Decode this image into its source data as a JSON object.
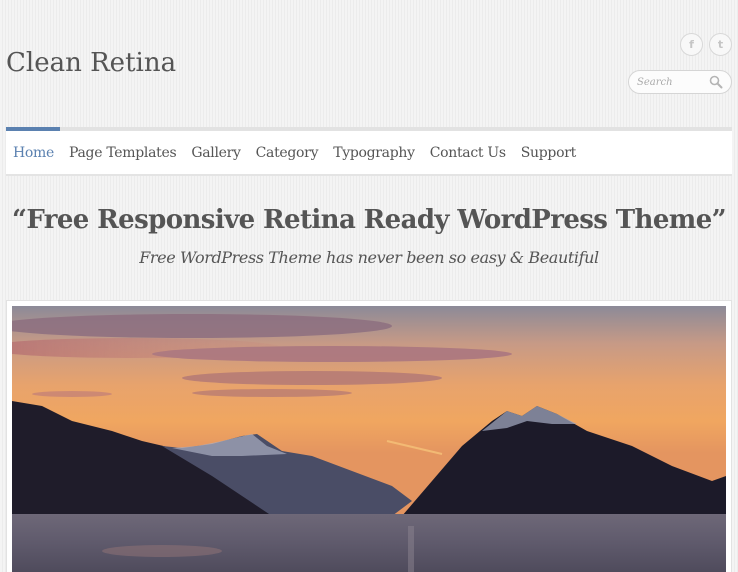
{
  "site": {
    "title": "Clean Retina"
  },
  "social": {
    "facebook": {
      "icon": "facebook-icon",
      "glyph": "f"
    },
    "twitter": {
      "icon": "twitter-icon",
      "glyph": "t"
    }
  },
  "search": {
    "placeholder": "Search",
    "value": "",
    "icon": "search-icon"
  },
  "nav": {
    "items": [
      {
        "label": "Home",
        "active": true
      },
      {
        "label": "Page Templates",
        "active": false
      },
      {
        "label": "Gallery",
        "active": false
      },
      {
        "label": "Category",
        "active": false
      },
      {
        "label": "Typography",
        "active": false
      },
      {
        "label": "Contact Us",
        "active": false
      },
      {
        "label": "Support",
        "active": false
      }
    ],
    "accent_color": "#5b81b0"
  },
  "hero": {
    "tagline": "“Free Responsive Retina Ready WordPress Theme”",
    "subtagline": "Free WordPress Theme has never been so easy & Beautiful"
  },
  "slider": {
    "image_description": "Sunset over mountains and water"
  }
}
